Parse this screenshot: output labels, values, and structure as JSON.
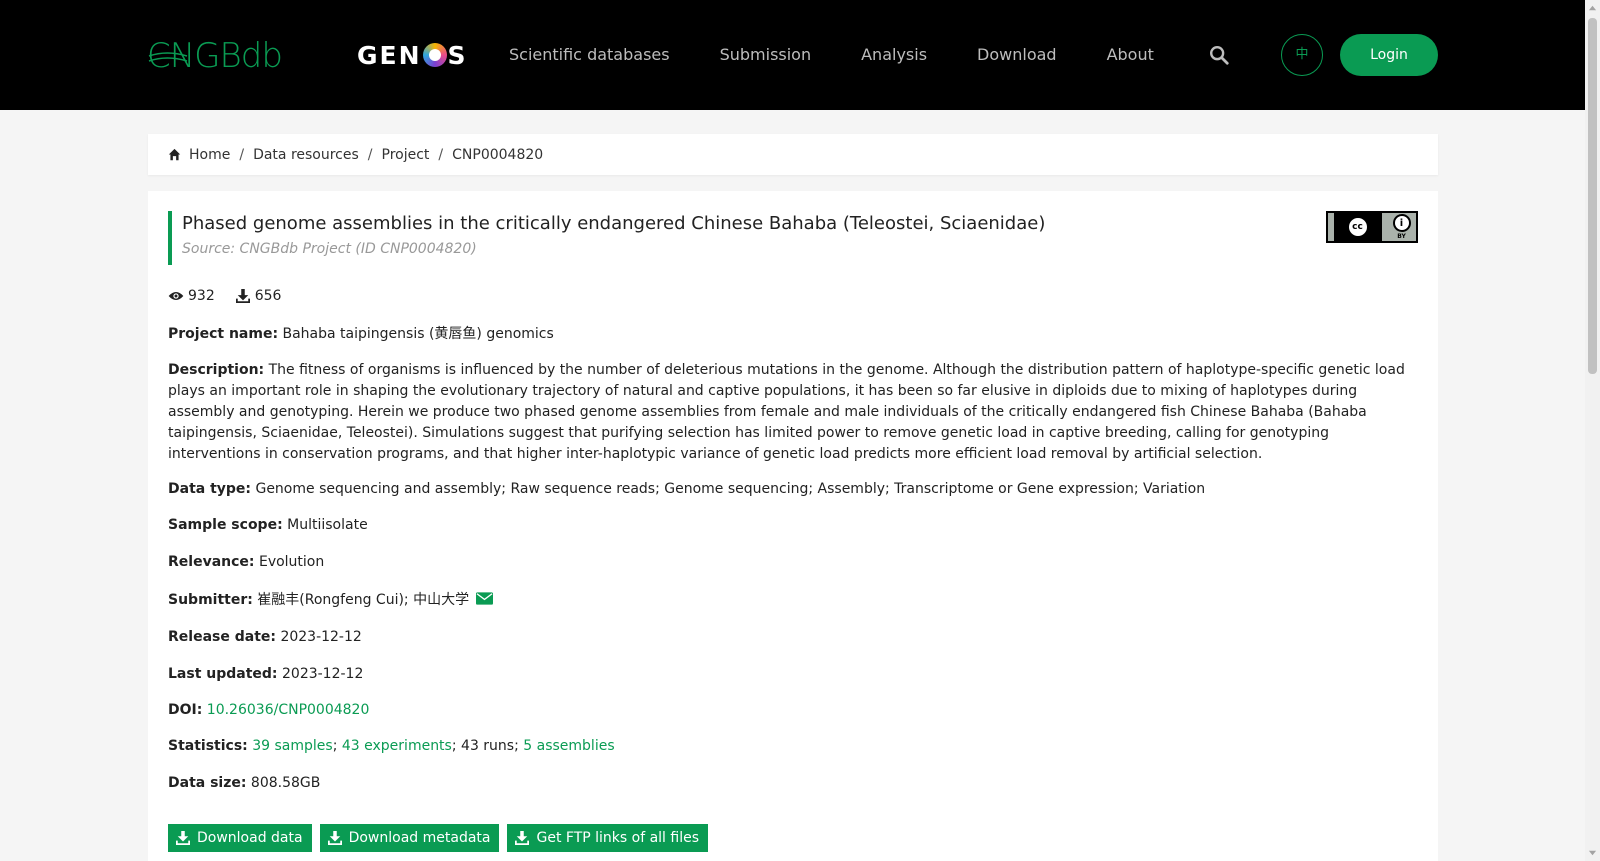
{
  "nav": {
    "brand_cngb": "CNGBdb",
    "brand_genos_left": "GEN",
    "brand_genos_right": "S",
    "links": [
      "Scientific databases",
      "Submission",
      "Analysis",
      "Download",
      "About"
    ],
    "lang_label": "中",
    "login_label": "Login",
    "accent_color": "#0a9b53"
  },
  "breadcrumb": {
    "items": [
      "Home",
      "Data resources",
      "Project"
    ],
    "current": "CNP0004820",
    "separator": "/"
  },
  "project": {
    "title": "Phased genome assemblies in the critically endangered Chinese Bahaba (Teleostei, Sciaenidae)",
    "source": "Source: CNGBdb Project (ID CNP0004820)",
    "license_badge": "BY",
    "views": "932",
    "downloads": "656",
    "fields": {
      "name_label": "Project name:",
      "name_value": "Bahaba taipingensis (黄唇鱼) genomics",
      "description_label": "Description:",
      "description_value": "The fitness of organisms is influenced by the number of deleterious mutations in the genome. Although the distribution pattern of haplotype-specific genetic load plays an important role in shaping the evolutionary trajectory of natural and captive populations, it has been so far elusive in diploids due to mixing of haplotypes during assembly and genotyping. Herein we produce two phased genome assemblies from female and male individuals of the critically endangered fish Chinese Bahaba (Bahaba taipingensis, Sciaenidae, Teleostei). Simulations suggest that purifying selection has limited power to remove genetic load in captive breeding, calling for genotyping interventions in conservation programs, and that higher inter-haplotypic variance of genetic load predicts more efficient load removal by artificial selection.",
      "data_type_label": "Data type:",
      "data_type_value": "Genome sequencing and assembly; Raw sequence reads; Genome sequencing; Assembly; Transcriptome or Gene expression; Variation",
      "sample_scope_label": "Sample scope:",
      "sample_scope_value": "Multiisolate",
      "relevance_label": "Relevance:",
      "relevance_value": "Evolution",
      "submitter_label": "Submitter:",
      "submitter_value": "崔融丰(Rongfeng Cui); 中山大学",
      "release_label": "Release date:",
      "release_value": "2023-12-12",
      "updated_label": "Last updated:",
      "updated_value": "2023-12-12",
      "doi_label": "DOI:",
      "doi_value": "10.26036/CNP0004820",
      "statistics_label": "Statistics:",
      "stat_samples": "39 samples",
      "stat_experiments": "43 experiments",
      "stat_runs": "43 runs",
      "stat_assemblies": "5 assemblies",
      "data_size_label": "Data size:",
      "data_size_value": "808.58GB"
    },
    "buttons": {
      "download_data": "Download data",
      "download_metadata": "Download metadata",
      "ftp_links": "Get FTP links of all files"
    }
  },
  "icons": {
    "search": "search-icon",
    "home": "home-icon",
    "eye": "eye-icon",
    "download": "download-icon",
    "mail": "envelope-icon",
    "license": "cc-by-icon"
  }
}
